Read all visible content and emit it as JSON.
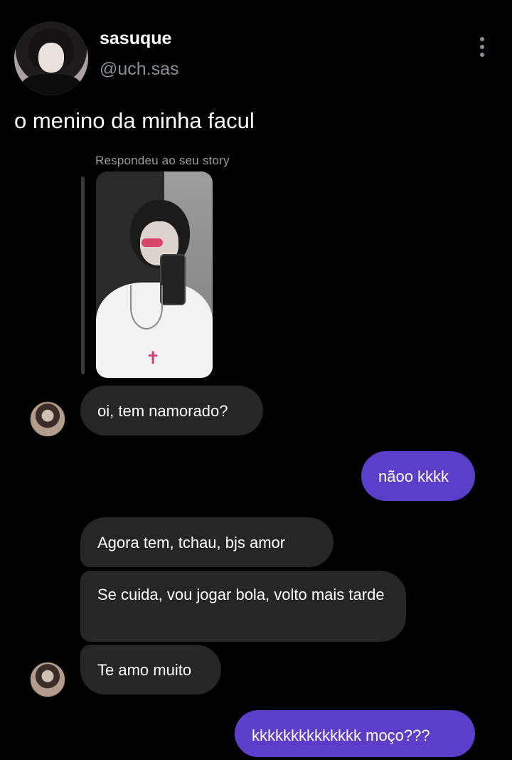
{
  "header": {
    "display_name": "sasuque",
    "handle": "@uch.sas",
    "avatar": "profile-avatar",
    "more_icon": "vertical-ellipsis-icon"
  },
  "tweet": {
    "text": "o menino da minha facul"
  },
  "dm": {
    "story_reply_label": "Respondeu ao seu story",
    "messages": [
      {
        "from": "them",
        "text": "oi, tem namorado?"
      },
      {
        "from": "me",
        "text": "nãoo kkkk"
      },
      {
        "from": "them",
        "text": "Agora tem, tchau, bjs amor"
      },
      {
        "from": "them",
        "text": "Se cuida, vou jogar bola, volto mais tarde"
      },
      {
        "from": "them",
        "text": "Te amo muito"
      },
      {
        "from": "me",
        "text": "kkkkkkkkkkkkkk moço???"
      }
    ]
  },
  "colors": {
    "background": "#000000",
    "incoming_bubble": "#262626",
    "outgoing_bubble": "#5b3ec9",
    "muted_text": "#8a8f96"
  }
}
